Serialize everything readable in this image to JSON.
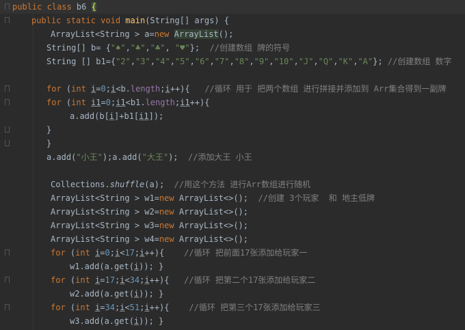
{
  "lines": [
    {
      "indent": 18,
      "parts": [
        [
          "kw",
          "public class "
        ],
        [
          "t",
          "b6 "
        ],
        [
          "hlY",
          "{"
        ]
      ]
    },
    {
      "indent": 46,
      "parts": [
        [
          "kw",
          "public static void "
        ],
        [
          "fn",
          "main"
        ],
        [
          "t",
          "(String[] args) {"
        ]
      ]
    },
    {
      "indent": 74,
      "parts": [
        [
          "t",
          "ArrayList<String > a="
        ],
        [
          "kw",
          "new "
        ],
        [
          "hlT",
          "ArrayList"
        ],
        [
          "t",
          "();"
        ]
      ]
    },
    {
      "indent": 68,
      "parts": [
        [
          "t",
          "String[] b= {"
        ],
        [
          "str",
          "\"♠\""
        ],
        [
          "t",
          ","
        ],
        [
          "str",
          "\"♣\""
        ],
        [
          "t",
          ","
        ],
        [
          "str",
          "\"♣\""
        ],
        [
          "t",
          ", "
        ],
        [
          "str",
          "\"♥\""
        ],
        [
          "t",
          "};  "
        ],
        [
          "cmt",
          "//创建数组 牌的符号"
        ]
      ]
    },
    {
      "indent": 68,
      "parts": [
        [
          "t",
          "String [] b1={"
        ],
        [
          "str",
          "\"2\""
        ],
        [
          "t",
          ","
        ],
        [
          "str",
          "\"3\""
        ],
        [
          "t",
          ","
        ],
        [
          "str",
          "\"4\""
        ],
        [
          "t",
          ","
        ],
        [
          "str",
          "\"5\""
        ],
        [
          "t",
          ","
        ],
        [
          "str",
          "\"6\""
        ],
        [
          "t",
          ","
        ],
        [
          "str",
          "\"7\""
        ],
        [
          "t",
          ","
        ],
        [
          "str",
          "\"8\""
        ],
        [
          "t",
          ","
        ],
        [
          "str",
          "\"9\""
        ],
        [
          "t",
          ","
        ],
        [
          "str",
          "\"10\""
        ],
        [
          "t",
          ","
        ],
        [
          "str",
          "\"J\""
        ],
        [
          "t",
          ","
        ],
        [
          "str",
          "\"Q\""
        ],
        [
          "t",
          ","
        ],
        [
          "str",
          "\"K\""
        ],
        [
          "t",
          ","
        ],
        [
          "str",
          "\"A\""
        ],
        [
          "t",
          "}; "
        ],
        [
          "cmt",
          "//创建数组 数字"
        ]
      ]
    },
    {
      "indent": 68,
      "parts": []
    },
    {
      "indent": 68,
      "parts": [
        [
          "kw",
          "for "
        ],
        [
          "t",
          "("
        ],
        [
          "kw",
          "int "
        ],
        [
          "ul",
          "i"
        ],
        [
          "t",
          "="
        ],
        [
          "num",
          "0"
        ],
        [
          "t",
          ";"
        ],
        [
          "ul",
          "i"
        ],
        [
          "t",
          "<b."
        ],
        [
          "field",
          "length"
        ],
        [
          "t",
          ";"
        ],
        [
          "ul",
          "i"
        ],
        [
          "t",
          "++){   "
        ],
        [
          "cmt",
          "//循环 用于 把两个数组 进行拼接并添加到 Arr集合得到一副牌"
        ]
      ]
    },
    {
      "indent": 68,
      "parts": [
        [
          "kw",
          "for "
        ],
        [
          "t",
          "("
        ],
        [
          "kw",
          "int "
        ],
        [
          "ul",
          "i1"
        ],
        [
          "t",
          "="
        ],
        [
          "num",
          "0"
        ],
        [
          "t",
          ";"
        ],
        [
          "ul",
          "i1"
        ],
        [
          "t",
          "<b1."
        ],
        [
          "field",
          "length"
        ],
        [
          "t",
          ";"
        ],
        [
          "ul",
          "i1"
        ],
        [
          "t",
          "++){"
        ]
      ]
    },
    {
      "indent": 102,
      "parts": [
        [
          "t",
          "a.add(b["
        ],
        [
          "ul",
          "i"
        ],
        [
          "t",
          "]+b1["
        ],
        [
          "ul",
          "i1"
        ],
        [
          "t",
          "]);"
        ]
      ]
    },
    {
      "indent": 68,
      "parts": [
        [
          "t",
          "}"
        ]
      ]
    },
    {
      "indent": 68,
      "parts": [
        [
          "t",
          "}"
        ]
      ]
    },
    {
      "indent": 68,
      "parts": [
        [
          "t",
          "a.add("
        ],
        [
          "str",
          "\"小王\""
        ],
        [
          "t",
          ");a.add("
        ],
        [
          "str",
          "\"大王\""
        ],
        [
          "t",
          ");  "
        ],
        [
          "cmt",
          "//添加大王 小王"
        ]
      ]
    },
    {
      "indent": 68,
      "parts": []
    },
    {
      "indent": 74,
      "parts": [
        [
          "t",
          "Collections."
        ],
        [
          "it",
          "shuffle"
        ],
        [
          "t",
          "(a);  "
        ],
        [
          "cmt",
          "//用这个方法 进行Arr数组进行随机"
        ]
      ]
    },
    {
      "indent": 74,
      "parts": [
        [
          "t",
          "ArrayList<String > w1="
        ],
        [
          "kw",
          "new "
        ],
        [
          "t",
          "ArrayList<>();  "
        ],
        [
          "cmt",
          "//创建 3个玩家  和 地主低牌"
        ]
      ]
    },
    {
      "indent": 74,
      "parts": [
        [
          "t",
          "ArrayList<String > w2="
        ],
        [
          "kw",
          "new "
        ],
        [
          "t",
          "ArrayList<>();"
        ]
      ]
    },
    {
      "indent": 74,
      "parts": [
        [
          "t",
          "ArrayList<String > w3="
        ],
        [
          "kw",
          "new "
        ],
        [
          "t",
          "ArrayList<>();"
        ]
      ]
    },
    {
      "indent": 74,
      "parts": [
        [
          "t",
          "ArrayList<String > w4="
        ],
        [
          "kw",
          "new "
        ],
        [
          "t",
          "ArrayList<>();"
        ]
      ]
    },
    {
      "indent": 74,
      "parts": [
        [
          "kw",
          "for "
        ],
        [
          "t",
          "("
        ],
        [
          "kw",
          "int "
        ],
        [
          "ul",
          "i"
        ],
        [
          "t",
          "="
        ],
        [
          "num",
          "0"
        ],
        [
          "t",
          ";"
        ],
        [
          "ul",
          "i"
        ],
        [
          "t",
          "<"
        ],
        [
          "num",
          "17"
        ],
        [
          "t",
          ";"
        ],
        [
          "ul",
          "i"
        ],
        [
          "t",
          "++){    "
        ],
        [
          "cmt",
          "//循环 把前面17张添加给玩家一"
        ]
      ]
    },
    {
      "indent": 102,
      "parts": [
        [
          "t",
          "w1.add(a.get("
        ],
        [
          "ul",
          "i"
        ],
        [
          "t",
          ")); }"
        ]
      ]
    },
    {
      "indent": 74,
      "parts": [
        [
          "kw",
          "for "
        ],
        [
          "t",
          "("
        ],
        [
          "kw",
          "int "
        ],
        [
          "ul",
          "i"
        ],
        [
          "t",
          "="
        ],
        [
          "num",
          "17"
        ],
        [
          "t",
          ";"
        ],
        [
          "ul",
          "i"
        ],
        [
          "t",
          "<"
        ],
        [
          "num",
          "34"
        ],
        [
          "t",
          ";"
        ],
        [
          "ul",
          "i"
        ],
        [
          "t",
          "++){   "
        ],
        [
          "cmt",
          "//循环 把第二个17张添加给玩家二"
        ]
      ]
    },
    {
      "indent": 102,
      "parts": [
        [
          "t",
          "w2.add(a.get("
        ],
        [
          "ul",
          "i"
        ],
        [
          "t",
          ")); }"
        ]
      ]
    },
    {
      "indent": 74,
      "parts": [
        [
          "kw",
          "for "
        ],
        [
          "t",
          "("
        ],
        [
          "kw",
          "int "
        ],
        [
          "ul",
          "i"
        ],
        [
          "t",
          "="
        ],
        [
          "num",
          "34"
        ],
        [
          "t",
          ";"
        ],
        [
          "ul",
          "i"
        ],
        [
          "t",
          "<"
        ],
        [
          "num",
          "51"
        ],
        [
          "t",
          ";"
        ],
        [
          "ul",
          "i"
        ],
        [
          "t",
          "++){    "
        ],
        [
          "cmt",
          "//循环 把第三个17张添加给玩家三"
        ]
      ]
    },
    {
      "indent": 102,
      "parts": [
        [
          "t",
          "w3.add(a.get("
        ],
        [
          "ul",
          "i"
        ],
        [
          "t",
          ")); }"
        ]
      ]
    }
  ]
}
